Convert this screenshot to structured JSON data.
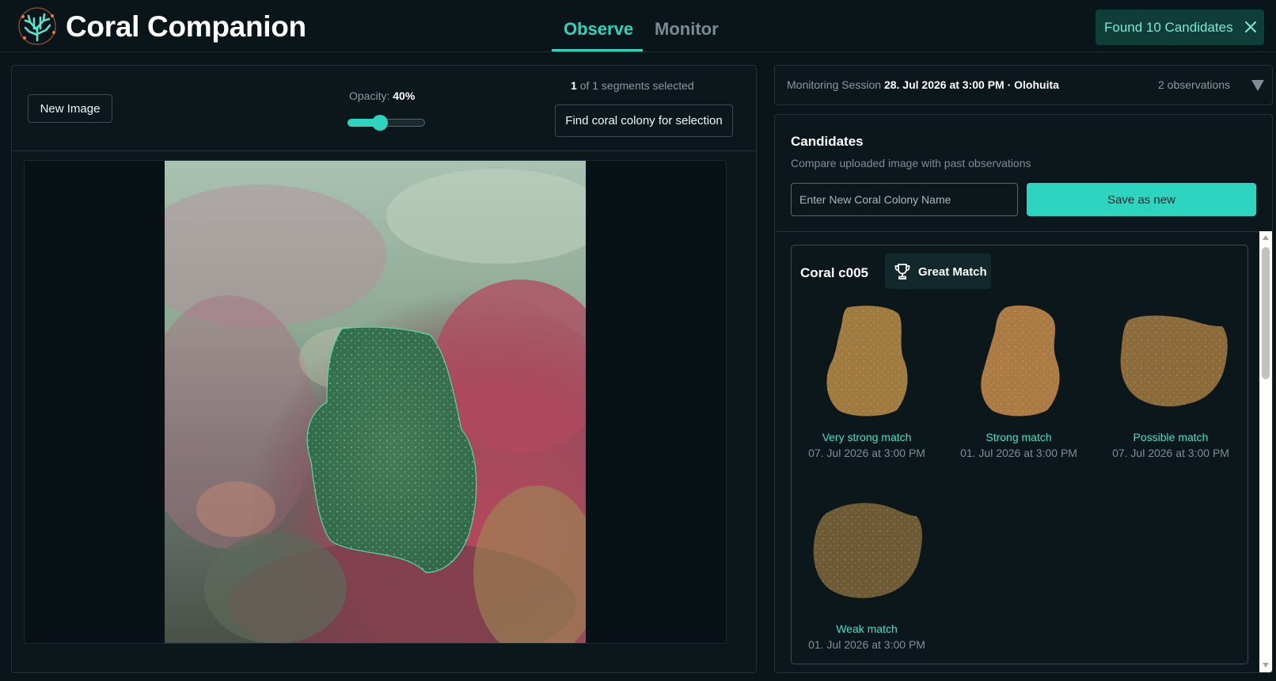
{
  "header": {
    "app_title": "Coral Companion",
    "logo_icon": "coral-branch-icon",
    "tabs": [
      {
        "label": "Observe",
        "active": true
      },
      {
        "label": "Monitor",
        "active": false
      }
    ],
    "toast": {
      "text": "Found 10 Candidates",
      "icon": "close-icon"
    }
  },
  "toolbar": {
    "new_image_label": "New Image",
    "opacity_label": "Opacity:",
    "opacity_value": "40%",
    "opacity_fraction": 0.4,
    "segments_count": "1",
    "segments_text": "of 1 segments selected",
    "find_button_label": "Find coral colony for selection"
  },
  "session": {
    "label": "Monitoring Session",
    "detail": "28. Jul 2026 at 3:00 PM · Olohuita",
    "observations": "2 observations",
    "toggle_icon": "caret-down-icon"
  },
  "candidates": {
    "title": "Candidates",
    "subtitle": "Compare uploaded image with past observations",
    "name_placeholder": "Enter New Coral Colony Name",
    "save_label": "Save as new",
    "cards": [
      {
        "name": "Coral c005",
        "badge_icon": "trophy-icon",
        "badge_label": "Great Match",
        "items": [
          {
            "label": "Very strong match",
            "date": "07. Jul 2026 at 3:00 PM"
          },
          {
            "label": "Strong match",
            "date": "01. Jul 2026 at 3:00 PM"
          },
          {
            "label": "Possible match",
            "date": "07. Jul 2026 at 3:00 PM"
          },
          {
            "label": "Weak match",
            "date": "01. Jul 2026 at 3:00 PM"
          }
        ]
      }
    ]
  },
  "colors": {
    "accent": "#2dd4bf",
    "background": "#0a1519",
    "panel": "#0b171b",
    "border": "#253339",
    "muted_text": "#8a98a0"
  }
}
